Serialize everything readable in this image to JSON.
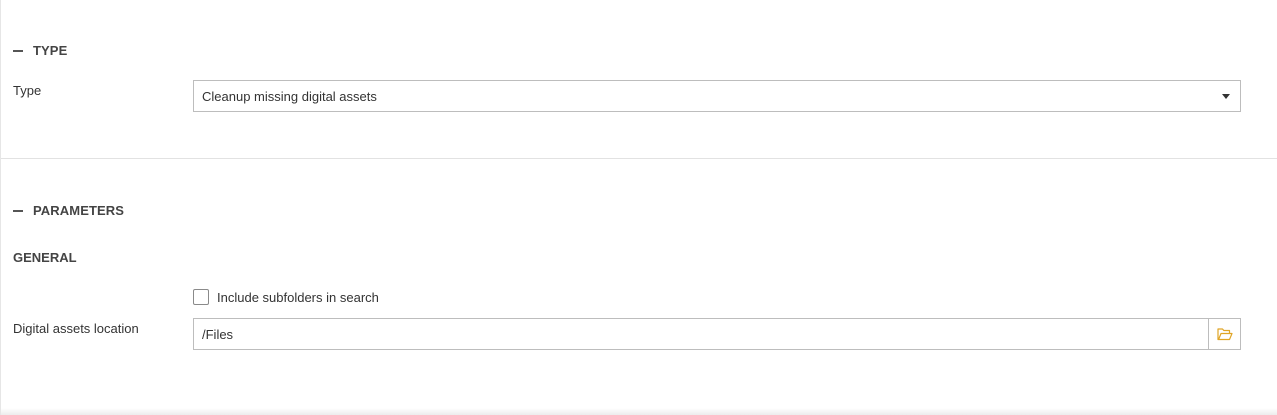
{
  "type_section": {
    "header": "TYPE",
    "type_label": "Type",
    "type_value": "Cleanup missing digital assets"
  },
  "parameters_section": {
    "header": "PARAMETERS",
    "general_header": "GENERAL",
    "include_subfolders_label": "Include subfolders in search",
    "include_subfolders_checked": false,
    "location_label": "Digital assets location",
    "location_value": "/Files"
  },
  "icons": {
    "collapse": "minus-icon",
    "dropdown": "caret-down-icon",
    "browse": "folder-open-icon"
  },
  "colors": {
    "folder_icon": "#e0a526",
    "border": "#bdbdbd"
  }
}
